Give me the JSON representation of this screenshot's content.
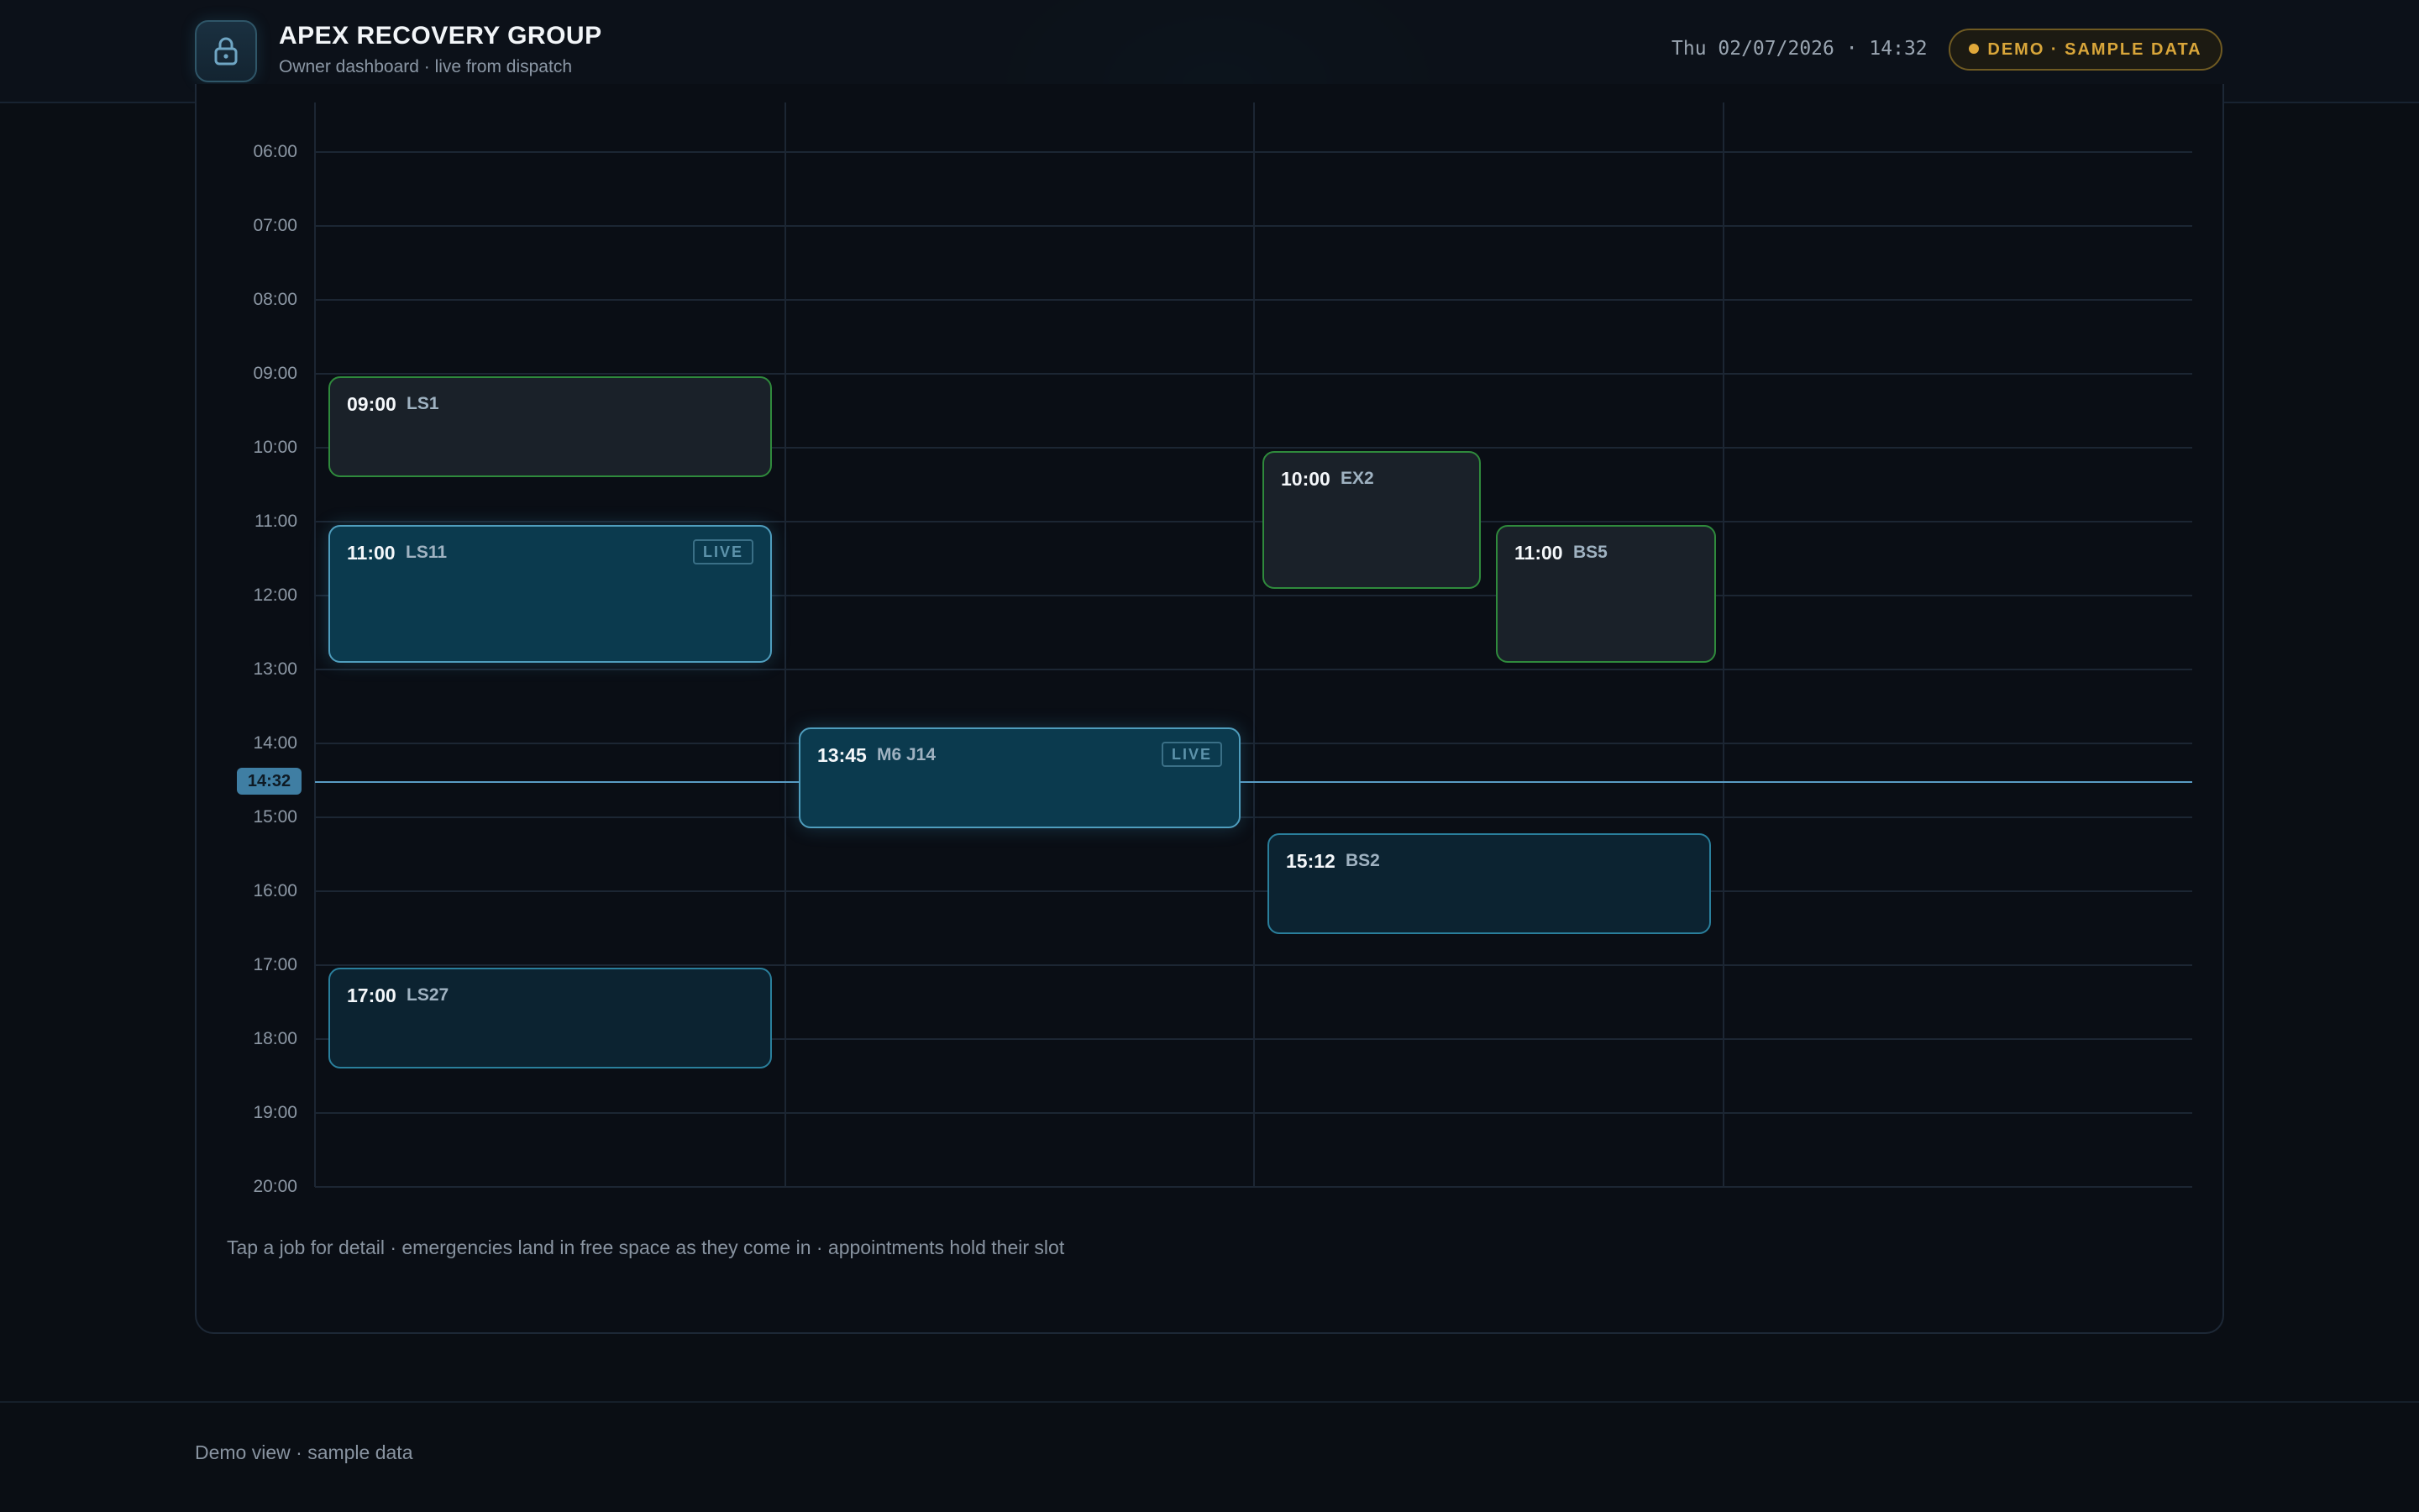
{
  "header": {
    "title": "APEX RECOVERY GROUP",
    "subtitle": "Owner dashboard · live from dispatch",
    "datetime": "Thu 02/07/2026 · 14:32",
    "demo_badge": "DEMO · SAMPLE DATA",
    "lock_icon": "lock-icon",
    "accent_color": "#d9a63a"
  },
  "schedule": {
    "hours": [
      "06:00",
      "07:00",
      "08:00",
      "09:00",
      "10:00",
      "11:00",
      "12:00",
      "13:00",
      "14:00",
      "15:00",
      "16:00",
      "17:00",
      "18:00",
      "19:00",
      "20:00"
    ],
    "now_label": "14:32",
    "jobs": [
      {
        "time": "09:00",
        "ref": "LS1",
        "live": "",
        "status": "green"
      },
      {
        "time": "11:00",
        "ref": "LS11",
        "live": "LIVE",
        "status": "live"
      },
      {
        "time": "17:00",
        "ref": "LS27",
        "live": "",
        "status": "booked"
      },
      {
        "time": "13:45",
        "ref": "M6 J14",
        "live": "LIVE",
        "status": "live"
      },
      {
        "time": "10:00",
        "ref": "EX2",
        "live": "",
        "status": "green"
      },
      {
        "time": "15:12",
        "ref": "BS2",
        "live": "",
        "status": "booked"
      },
      {
        "time": "11:00",
        "ref": "BS5",
        "live": "",
        "status": "green"
      }
    ],
    "footnote": "Tap a job for detail · emergencies land in free space as they come in · appointments hold their slot",
    "colors": {
      "confirmed_border": "#2f8a3c",
      "live_border": "#4f9dbd",
      "booked_border": "#2a7f9c",
      "now_line": "#5a9cc4"
    }
  },
  "footer": {
    "text": "Demo view · sample data"
  }
}
